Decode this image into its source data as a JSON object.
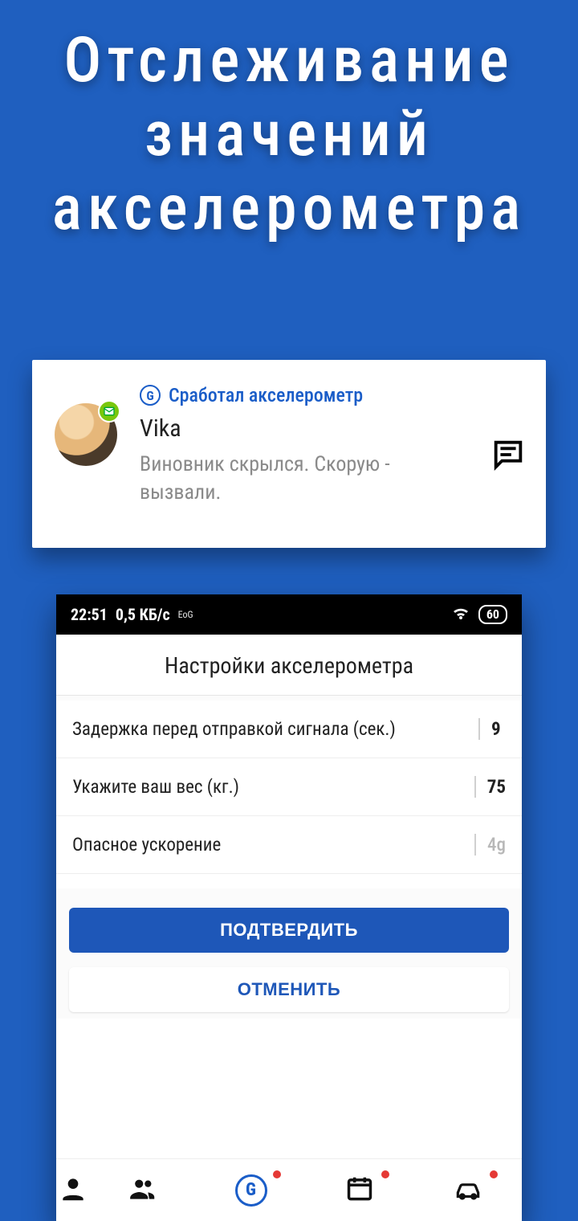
{
  "banner": {
    "line1": "Отслеживание",
    "line2": "значений",
    "line3": "акселерометра"
  },
  "notification": {
    "app_indicator": "G",
    "header": "Сработал акселерометр",
    "name": "Vika",
    "message": "Виновник скрылся. Скорую - вызвали."
  },
  "phone": {
    "status": {
      "time": "22:51",
      "net_speed": "0,5 КБ/с",
      "tag": "EoG",
      "battery": "60"
    },
    "title": "Настройки акселерометра",
    "settings": {
      "delay_label": "Задержка перед отправкой сигнала (сек.)",
      "delay_value": "9",
      "weight_label": "Укажите ваш вес (кг.)",
      "weight_value": "75",
      "accel_label": "Опасное ускорение",
      "accel_value": "4g"
    },
    "buttons": {
      "confirm": "ПОДТВЕРДИТЬ",
      "cancel": "ОТМЕНИТЬ"
    }
  }
}
